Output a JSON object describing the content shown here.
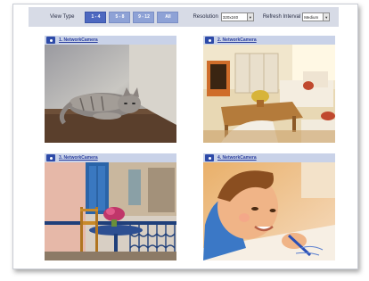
{
  "toolbar": {
    "view_type_label": "View Type",
    "view_buttons": [
      "1 - 4",
      "5 - 8",
      "9 - 12",
      "All"
    ],
    "active_view": "1 - 4",
    "resolution_label": "Resolution",
    "resolution_value": "320x240",
    "refresh_label": "Refresh Interval",
    "refresh_value": "Medium"
  },
  "cameras": [
    {
      "label": "1. NetworkCamera",
      "scene": "cat-icon"
    },
    {
      "label": "2. NetworkCamera",
      "scene": "living-room-icon"
    },
    {
      "label": "3. NetworkCamera",
      "scene": "balcony-icon"
    },
    {
      "label": "4. NetworkCamera",
      "scene": "child-drawing-icon"
    }
  ],
  "colors": {
    "toolbar_bg": "#d7dbe6",
    "button_active": "#4d68c0",
    "button": "#8ea2d6",
    "header_bg": "#c9d2e8",
    "link": "#2b3f9e"
  }
}
